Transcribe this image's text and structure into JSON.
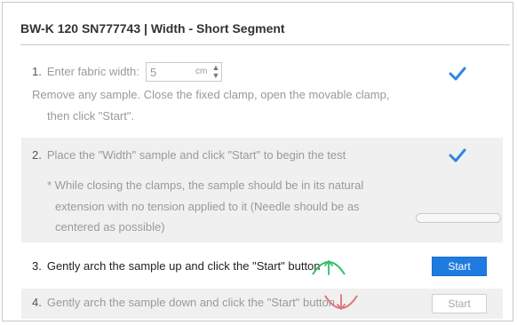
{
  "window": {
    "title": "BW-K 120 SN777743 | Width - Short Segment"
  },
  "steps": [
    {
      "number": "1.",
      "lines": [
        "Enter fabric width:",
        "Remove any sample. Close the fixed clamp, open the movable clamp,",
        "then click \"Start\"."
      ],
      "input": {
        "value": "5",
        "unit": "cm"
      },
      "status": "complete"
    },
    {
      "number": "2.",
      "lines": [
        "Place the \"Width\" sample and click \"Start\" to begin the test"
      ],
      "notes": [
        "* While closing the clamps, the sample should be in its natural",
        "extension with no tension applied to it (Needle should be as",
        "centered as possible)"
      ],
      "status": "complete",
      "progress": 0
    },
    {
      "number": "3.",
      "lines": [
        "Gently arch the sample up and click the \"Start\" button"
      ],
      "button": "Start",
      "status": "active"
    },
    {
      "number": "4.",
      "lines": [
        "Gently arch the sample down and click the \"Start\" button"
      ],
      "button": "Start",
      "status": "disabled"
    }
  ],
  "colors": {
    "accent": "#1f7be0",
    "check": "#2f86e0",
    "arch_up": "#2fbf6a",
    "arch_down": "#e0707a",
    "panel_bg": "#f0f0f0"
  },
  "icons": {
    "checkmark": "check-icon",
    "arch_up": "arch-up-icon",
    "arch_down": "arch-down-icon",
    "spinner_up": "▲",
    "spinner_down": "▼"
  }
}
